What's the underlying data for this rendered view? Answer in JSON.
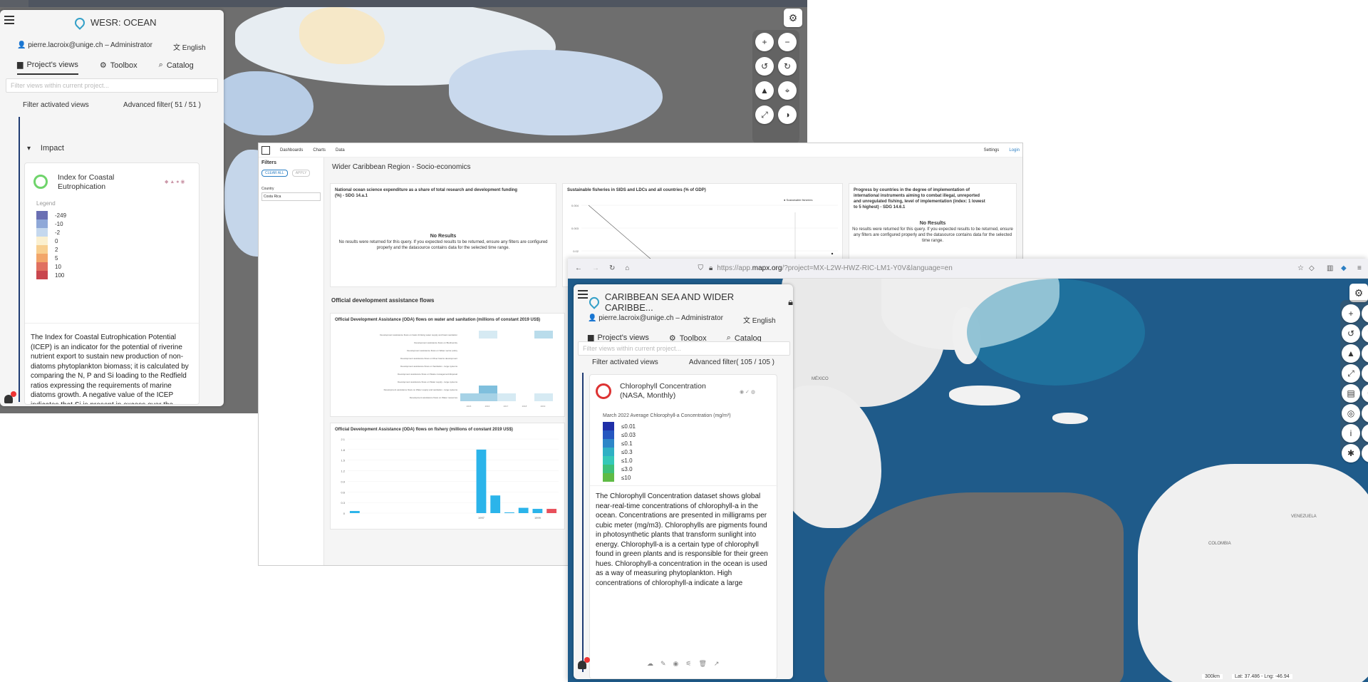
{
  "left_window": {
    "app_title": "WESR: OCEAN",
    "user": "pierre.lacroix@unige.ch – Administrator",
    "language": "English",
    "tabs": [
      "Project's views",
      "Toolbox",
      "Catalog"
    ],
    "search_placeholder": "Filter views within current project...",
    "filter_activated": "Filter activated views",
    "advanced_filter": "Advanced filter",
    "advanced_filter_count": "( 51 / 51 )",
    "group_label": "Impact",
    "view_title": "Index for Coastal Eutrophication",
    "legend_label": "Legend",
    "legend": [
      {
        "label": "-249",
        "color": "#6a6fb3"
      },
      {
        "label": "-10",
        "color": "#8fa8d8"
      },
      {
        "label": "-2",
        "color": "#c5d8ee"
      },
      {
        "label": "0",
        "color": "#fbf0d0"
      },
      {
        "label": "2",
        "color": "#f8cf90"
      },
      {
        "label": "5",
        "color": "#f2a66a"
      },
      {
        "label": "10",
        "color": "#e07060"
      },
      {
        "label": "100",
        "color": "#c9464e"
      }
    ],
    "description": "The Index for Coastal Eutrophication Potential (ICEP) is an indicator for the potential of riverine nutrient export to sustain new production of non-diatoms phytoplankton biomass; it is calculated by comparing the N, P and Si loading to the Redfield ratios expressing the requirements of marine diatoms growth. A negative value of the ICEP indicates that Si is present in excess over the other nutrients and"
  },
  "dashboard": {
    "nav": [
      "Dashboards",
      "Charts",
      "Data"
    ],
    "nav_right": [
      "Settings",
      "Login"
    ],
    "filters_label": "Filters",
    "clear_all": "CLEAR ALL",
    "apply": "APPLY",
    "country_label": "Country",
    "country_value": "Costa Rica",
    "title": "Wider Caribbean Region - Socio-economics",
    "cards": {
      "c1_title": "National ocean science expenditure as a share of total research and development funding (%) - SDG 14.a.1",
      "c2_title": "Sustainable fisheries in SIDS and LDCs and all countries (% of GDP)",
      "c3_title": "Progress by countries in the degree of implementation of international instruments aiming to combat illegal, unreported and unregulated fishing, level of implementation (index: 1 lowest to 5 highest) - SDG 14.6.1",
      "no_results": "No Results",
      "no_results_text": "No results were returned for this query. If you expected results to be returned, ensure any filters are configured properly and the datasource contains data for the selected time range.",
      "section2": "Official development assistance flows",
      "c4_title": "Official Development Assistance (ODA) flows on water and sanitation (millions of constant 2019 US$)",
      "c5_title": "Official Development Assistance (ODA) flows on fishery (millions of constant 2019 US$)",
      "legend_item": "Sustainable fisheries"
    },
    "heat_rows": [
      "Development assistance flows on basic drinking water supply and basic sanitation",
      "Development assistance flows on Biodiversity",
      "Development assistance flows on Water sector policy",
      "Development assistance flows on River basins development",
      "Development assistance flows on Sanitation - large systems",
      "Development assistance flows on Waste management/disposal",
      "Development assistance flows on Water supply - large systems",
      "Development assistance flows on Water supply and sanitation - large systems",
      "Development assistance flows on Water resources"
    ],
    "heat_x": [
      "2015",
      "2016",
      "2017",
      "2018",
      "2019"
    ],
    "chart_data": [
      {
        "type": "bar",
        "x_ticks": [
          "1997",
          "1999"
        ],
        "values": [
          0.06,
          0,
          0,
          0,
          0,
          0,
          0,
          0,
          0,
          1.8,
          0.5,
          0.02,
          0.15,
          0.12,
          0.12
        ],
        "colors": [
          "#2bb4ea",
          "#2bb4ea",
          "#2bb4ea",
          "#2bb4ea",
          "#2bb4ea",
          "#2bb4ea",
          "#2bb4ea",
          "#2bb4ea",
          "#2bb4ea",
          "#2bb4ea",
          "#2bb4ea",
          "#2bb4ea",
          "#2bb4ea",
          "#2bb4ea",
          "#e8505b"
        ],
        "y_ticks": [
          "2.1",
          "1.8",
          "1.5",
          "1.2",
          "0.9",
          "0.6",
          "0.3",
          "0"
        ],
        "ylim": [
          0,
          2.1
        ]
      },
      {
        "type": "line",
        "y_ticks": [
          "0.004",
          "0.003",
          "0.02"
        ],
        "x": [
          0,
          1
        ],
        "y": [
          0.004,
          0.001
        ]
      }
    ]
  },
  "right_window": {
    "url_prefix": "https://app.",
    "url_domain": "mapx.org",
    "url_rest": "/?project=MX-L2W-HWZ-RIC-LM1-Y0V&language=en",
    "app_title": "CARIBBEAN SEA AND WIDER CARIBBE...",
    "user": "pierre.lacroix@unige.ch – Administrator",
    "language": "English",
    "tabs": [
      "Project's views",
      "Toolbox",
      "Catalog"
    ],
    "search_placeholder": "Filter views within current project...",
    "filter_activated": "Filter activated views",
    "advanced_filter": "Advanced filter",
    "advanced_filter_count": "( 105 / 105 )",
    "view_title": "Chlorophyll Concentration (NASA, Monthly)",
    "legend_title": "March 2022 Average Chlorophyll-a Concentration (mg/m³)",
    "legend": [
      {
        "label": "≤0.01",
        "color": "#1f2fa8"
      },
      {
        "label": "≤0.03",
        "color": "#2557c0"
      },
      {
        "label": "≤0.1",
        "color": "#2d86c8"
      },
      {
        "label": "≤0.3",
        "color": "#2fb0c4"
      },
      {
        "label": "≤1.0",
        "color": "#35c8b8"
      },
      {
        "label": "≤3.0",
        "color": "#3ec07a"
      },
      {
        "label": "≤10",
        "color": "#5fbb45"
      }
    ],
    "description": "The Chlorophyll Concentration dataset shows global near-real-time concentrations of chlorophyll-a in the ocean. Concentrations are presented in milligrams per cubic meter (mg/m3). Chlorophylls are pigments found in photosynthetic plants that transform sunlight into energy. Chlorophyll-a is a certain type of chlorophyll found in green plants and is responsible for their green hues. Chlorophyll-a concentration in the ocean is used as a way of measuring phytoplankton. High concentrations of chlorophyll-a indicate a large",
    "map_labels": [
      "MÉXICO",
      "VENEZUELA",
      "COLOMBIA"
    ],
    "scale": "300km",
    "coords": "Lat: 37.486 - Lng: -46.94"
  }
}
